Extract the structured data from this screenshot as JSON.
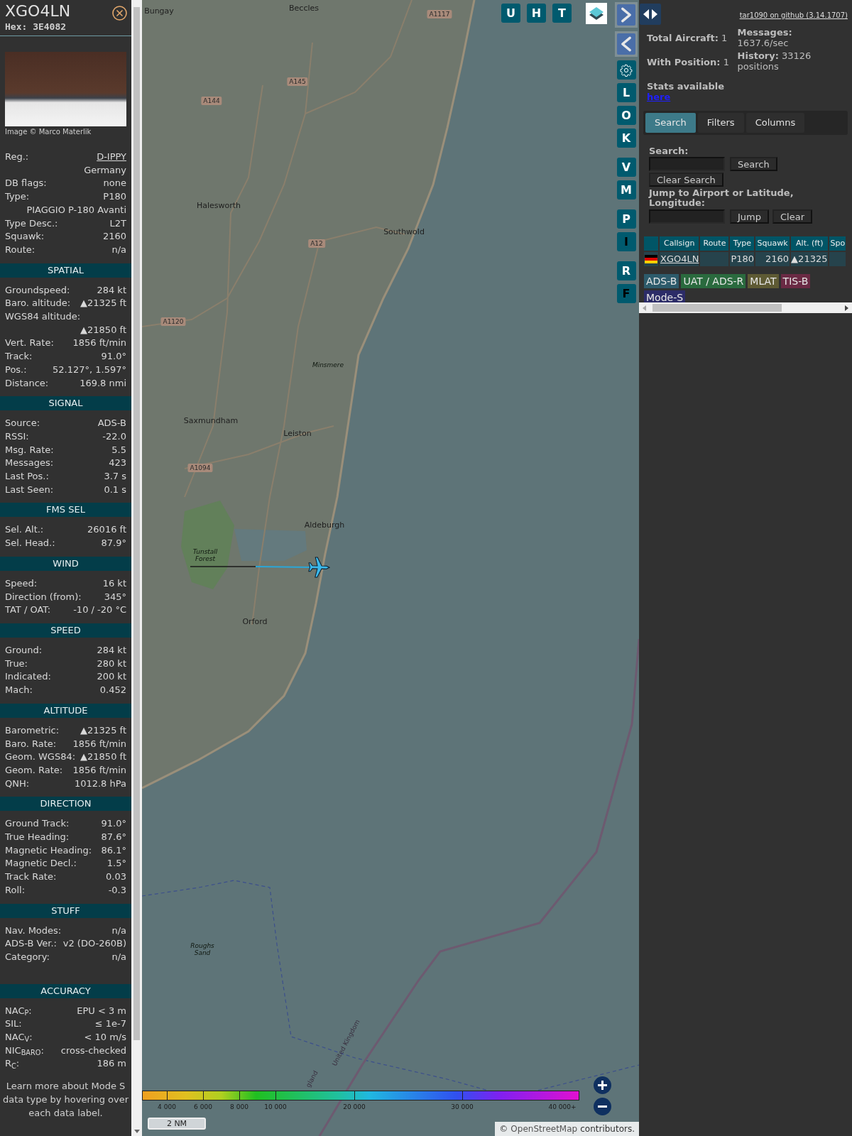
{
  "aircraft_panel": {
    "callsign": "XGO4LN",
    "hex": "Hex: 3E4082",
    "photo_credit": "Image © Marco Materlik",
    "sections": [
      {
        "rows": [
          {
            "kind": "link",
            "label": "Reg.:",
            "value": "D-IPPY"
          },
          {
            "kind": "value",
            "value": "Germany"
          },
          {
            "kind": "pair",
            "label": "DB flags:",
            "value": "none"
          },
          {
            "kind": "pair",
            "label": "Type:",
            "value": "P180"
          },
          {
            "kind": "value",
            "value": "PIAGGIO P-180 Avanti"
          },
          {
            "kind": "pair",
            "label": "Type Desc.:",
            "value": "L2T"
          },
          {
            "kind": "pair",
            "label": "Squawk:",
            "value": "2160"
          },
          {
            "kind": "pair",
            "label": "Route:",
            "value": "n/a"
          }
        ]
      },
      {
        "title": "SPATIAL",
        "rows": [
          {
            "kind": "pair",
            "label": "Groundspeed:",
            "value": "284 kt"
          },
          {
            "kind": "pair",
            "label": "Baro. altitude:",
            "value": "▲21325 ft"
          },
          {
            "kind": "label",
            "label": "WGS84 altitude:"
          },
          {
            "kind": "value",
            "value": "▲21850 ft"
          },
          {
            "kind": "pair",
            "label": "Vert. Rate:",
            "value": "1856 ft/min"
          },
          {
            "kind": "pair",
            "label": "Track:",
            "value": "91.0°"
          },
          {
            "kind": "pair",
            "label": "Pos.:",
            "value": "52.127°, 1.597°"
          },
          {
            "kind": "pair",
            "label": "Distance:",
            "value": "169.8 nmi"
          }
        ]
      },
      {
        "title": "SIGNAL",
        "rows": [
          {
            "kind": "pair",
            "label": "Source:",
            "value": "ADS-B"
          },
          {
            "kind": "pair",
            "label": "RSSI:",
            "value": "-22.0"
          },
          {
            "kind": "pair",
            "label": "Msg. Rate:",
            "value": "5.5"
          },
          {
            "kind": "pair",
            "label": "Messages:",
            "value": "423"
          },
          {
            "kind": "pair",
            "label": "Last Pos.:",
            "value": "3.7 s"
          },
          {
            "kind": "pair",
            "label": "Last Seen:",
            "value": "0.1 s"
          }
        ]
      },
      {
        "title": "FMS SEL",
        "rows": [
          {
            "kind": "pair",
            "label": "Sel. Alt.:",
            "value": "26016 ft"
          },
          {
            "kind": "pair",
            "label": "Sel. Head.:",
            "value": "87.9°"
          }
        ]
      },
      {
        "title": "WIND",
        "rows": [
          {
            "kind": "pair",
            "label": "Speed:",
            "value": "16 kt"
          },
          {
            "kind": "pair",
            "label": "Direction (from):",
            "value": "345°"
          },
          {
            "kind": "pair",
            "label": "TAT / OAT:",
            "value": "-10 / -20 °C"
          }
        ]
      },
      {
        "title": "SPEED",
        "rows": [
          {
            "kind": "pair",
            "label": "Ground:",
            "value": "284 kt"
          },
          {
            "kind": "pair",
            "label": "True:",
            "value": "280 kt"
          },
          {
            "kind": "pair",
            "label": "Indicated:",
            "value": "200 kt"
          },
          {
            "kind": "pair",
            "label": "Mach:",
            "value": "0.452"
          }
        ]
      },
      {
        "title": "ALTITUDE",
        "rows": [
          {
            "kind": "pair",
            "label": "Barometric:",
            "value": "▲21325 ft"
          },
          {
            "kind": "pair",
            "label": "Baro. Rate:",
            "value": "1856 ft/min"
          },
          {
            "kind": "pair",
            "label": "Geom. WGS84:",
            "value": "▲21850 ft"
          },
          {
            "kind": "pair",
            "label": "Geom. Rate:",
            "value": "1856 ft/min"
          },
          {
            "kind": "pair",
            "label": "QNH:",
            "value": "1012.8 hPa"
          }
        ]
      },
      {
        "title": "DIRECTION",
        "rows": [
          {
            "kind": "pair",
            "label": "Ground Track:",
            "value": "91.0°"
          },
          {
            "kind": "pair",
            "label": "True Heading:",
            "value": "87.6°"
          },
          {
            "kind": "pair",
            "label": "Magnetic Heading:",
            "value": "86.1°"
          },
          {
            "kind": "pair",
            "label": "Magnetic Decl.:",
            "value": "1.5°"
          },
          {
            "kind": "pair",
            "label": "Track Rate:",
            "value": "0.03"
          },
          {
            "kind": "pair",
            "label": "Roll:",
            "value": "-0.3"
          }
        ]
      },
      {
        "title": "STUFF",
        "rows": [
          {
            "kind": "pair",
            "label": "Nav. Modes:",
            "value": "n/a"
          },
          {
            "kind": "pair",
            "label": "ADS-B Ver.:",
            "value": "v2 (DO-260B)"
          },
          {
            "kind": "pair",
            "label": "Category:",
            "value": "n/a"
          }
        ]
      },
      {
        "title": "ACCURACY",
        "rows": [
          {
            "kind": "pair",
            "label": "NAC$_{P}$:",
            "value": "EPU < 3 m"
          },
          {
            "kind": "pair",
            "label": "SIL:",
            "value": "≤ 1e-7"
          },
          {
            "kind": "pair",
            "label": "NAC$_{V}$:",
            "value": "< 10 m/s"
          },
          {
            "kind": "pair",
            "label": "NIC$_{BARO}$:",
            "value": "cross-checked"
          },
          {
            "kind": "pair",
            "label": "R$_{C}$:",
            "value": "186 m"
          }
        ]
      }
    ],
    "footer": "Learn more about Mode S data type by hovering over each data label."
  },
  "map": {
    "places": [
      {
        "kind": "town",
        "label": "Bungay"
      },
      {
        "kind": "town",
        "label": "Beccles"
      },
      {
        "kind": "road",
        "label": "A1117"
      },
      {
        "kind": "road",
        "label": "A145"
      },
      {
        "kind": "road",
        "label": "A144"
      },
      {
        "kind": "town",
        "label": "Halesworth"
      },
      {
        "kind": "road",
        "label": "A12"
      },
      {
        "kind": "town",
        "label": "Southwold"
      },
      {
        "kind": "road",
        "label": "A1120"
      },
      {
        "kind": "area",
        "label": "Minsmere"
      },
      {
        "kind": "town",
        "label": "Saxmundham"
      },
      {
        "kind": "town",
        "label": "Leiston"
      },
      {
        "kind": "road",
        "label": "A1094"
      },
      {
        "kind": "town",
        "label": "Aldeburgh"
      },
      {
        "kind": "area",
        "label": "Tunstall Forest"
      },
      {
        "kind": "town",
        "label": "Orford"
      },
      {
        "kind": "area",
        "label": "Roughs Sand"
      },
      {
        "kind": "border",
        "label": "United Kingdom"
      },
      {
        "kind": "border",
        "label": "gland"
      }
    ],
    "top_buttons": [
      {
        "label": "U"
      },
      {
        "label": "H"
      },
      {
        "label": "T"
      }
    ],
    "side_buttons": [
      {
        "kind": "next"
      },
      {
        "kind": "prev"
      },
      {
        "kind": "gear"
      },
      {
        "kind": "letter",
        "label": "L",
        "active": false
      },
      {
        "kind": "letter",
        "label": "O",
        "active": false
      },
      {
        "kind": "letter",
        "label": "K",
        "active": false
      },
      {
        "kind": "letter",
        "label": "V",
        "active": false
      },
      {
        "kind": "letter",
        "label": "M",
        "active": false
      },
      {
        "kind": "letter",
        "label": "P",
        "active": false
      },
      {
        "kind": "letter",
        "label": "I",
        "active": true
      },
      {
        "kind": "letter",
        "label": "R",
        "active": false
      },
      {
        "kind": "letter",
        "label": "F",
        "active": true
      }
    ],
    "altitude_legend": [
      "4 000",
      "6 000",
      "8 000",
      "10 000",
      "20 000",
      "30 000",
      "40 000+"
    ],
    "scale": "2 NM",
    "attribution": {
      "prefix": "©",
      "link": "OpenStreetMap",
      "suffix": "contributors."
    }
  },
  "sidebar": {
    "version_link": "tar1090 on github (3.14.1707)",
    "stats_left": [
      {
        "label": "Total Aircraft:",
        "value": "1"
      },
      {
        "label": "With Position:",
        "value": "1"
      }
    ],
    "stats_link": {
      "label": "Stats available",
      "link": "here"
    },
    "stats_right": [
      {
        "label": "Messages:",
        "value": "1637.6/sec"
      },
      {
        "label": "History:",
        "value": "33126 positions"
      }
    ],
    "tabs": [
      {
        "label": "Search",
        "selected": true
      },
      {
        "label": "Filters",
        "selected": false
      },
      {
        "label": "Columns",
        "selected": false
      }
    ],
    "search": {
      "label": "Search:",
      "button": "Search",
      "clear_button": "Clear Search"
    },
    "jump": {
      "label": "Jump to Airport or Latitude, Longitude:",
      "button": "Jump",
      "clear_button": "Clear"
    },
    "table": {
      "columns": [
        "Callsign",
        "Route",
        "Type",
        "Squawk",
        "Alt. (ft)",
        "Spo"
      ],
      "rows": [
        {
          "callsign": "XGO4LN",
          "type": "P180",
          "squawk": "2160",
          "altitude": "▲21325"
        }
      ]
    },
    "sources": [
      {
        "label": "ADS-B",
        "color": "#2d5b6b"
      },
      {
        "label": "UAT / ADS-R",
        "color": "#2a6a3e"
      },
      {
        "label": "MLAT",
        "color": "#5e5a34"
      },
      {
        "label": "TIS-B",
        "color": "#6a2a44"
      },
      {
        "label": "Mode-S",
        "color": "#2c2c68"
      }
    ]
  }
}
